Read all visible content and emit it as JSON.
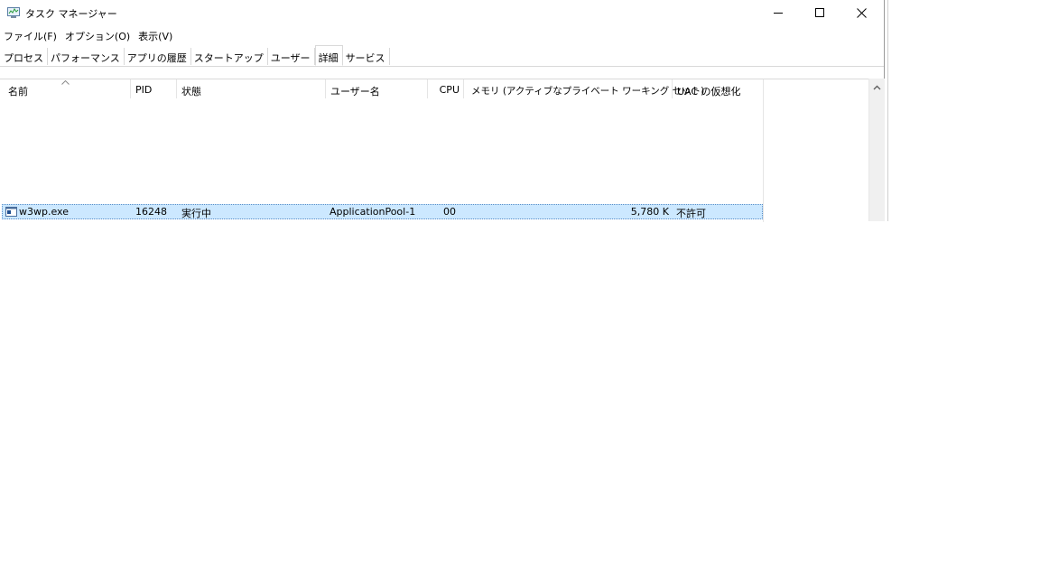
{
  "window": {
    "title": "タスク マネージャー"
  },
  "menu": {
    "items": [
      "ファイル(F)",
      "オプション(O)",
      "表示(V)"
    ]
  },
  "tabs": {
    "items": [
      "プロセス",
      "パフォーマンス",
      "アプリの履歴",
      "スタートアップ",
      "ユーザー",
      "詳細",
      "サービス"
    ],
    "active": "詳細"
  },
  "table": {
    "columns": [
      "名前",
      "PID",
      "状態",
      "ユーザー名",
      "CPU",
      "メモリ (アクティブなプライベート ワーキング セット)",
      "UAC の仮想化"
    ],
    "rows": [
      {
        "name": "w3wp.exe",
        "pid": "16248",
        "status": "実行中",
        "user": "ApplicationPool-1",
        "cpu": "00",
        "memory": "5,780 K",
        "uac": "不許可"
      }
    ]
  },
  "colors": {
    "selection": "#cce8ff",
    "selection_border": "#5a8fc8",
    "scrollbar": "#f0f0f0"
  }
}
